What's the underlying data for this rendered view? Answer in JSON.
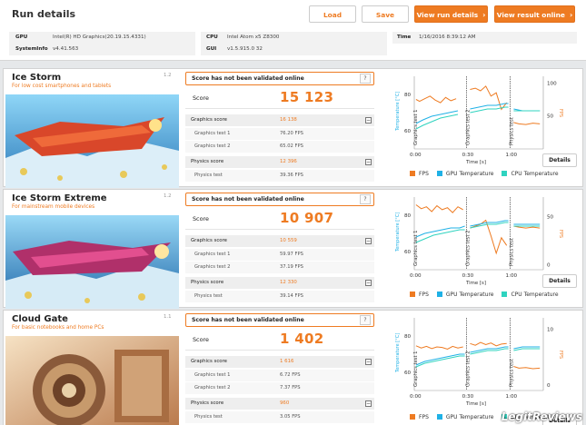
{
  "header": {
    "title": "Run details",
    "load_label": "Load",
    "save_label": "Save",
    "view_run_label": "View run details",
    "view_result_label": "View result online",
    "gpu_key": "GPU",
    "gpu_value": "Intel(R) HD Graphics(20.19.15.4331)",
    "cpu_key": "CPU",
    "cpu_value": "Intel Atom x5 Z8300",
    "time_key": "Time",
    "time_value": "1/16/2016 8:39:12 AM",
    "sysinfo_key": "SystemInfo",
    "sysinfo_value": "v4.41.563",
    "gui_key": "GUI",
    "gui_value": "v1.5.915.0 32"
  },
  "common": {
    "not_validated": "Score has not been validated online",
    "question": "?",
    "score_label": "Score",
    "graphics_score_label": "Graphics score",
    "physics_score_label": "Physics score",
    "gt1_label": "Graphics test 1",
    "gt2_label": "Graphics test 2",
    "pt_label": "Physics test",
    "details_label": "Details",
    "time_axis_label": "Time [s]",
    "temp_axis_label": "Temperature [°C]",
    "fps_axis_label": "FPS",
    "legend_fps": "FPS",
    "legend_gpu": "GPU Temperature",
    "legend_cpu": "CPU Temperature",
    "x_ticks": [
      "0:00",
      "0:30",
      "1:00"
    ],
    "watermark": "LegitReviews"
  },
  "colors": {
    "accent": "#ee7b22",
    "gpu": "#1fb1e6",
    "cpu": "#2fd3bf"
  },
  "benchmarks": [
    {
      "name": "Ice Storm",
      "subtitle": "For low cost smartphones and tablets",
      "version": "1.2",
      "score": "15 123",
      "graphics_score": "16 138",
      "gt1": "76.20 FPS",
      "gt2": "65.02 FPS",
      "physics_score": "12 396",
      "physics_test": "39.36 FPS",
      "temp_ticks": [
        "80",
        "60"
      ],
      "fps_ticks": [
        "100",
        "50"
      ],
      "chart_data": {
        "type": "line",
        "segments": [
          "Graphics test 1",
          "Graphics test 2",
          "Physics test"
        ],
        "series": [
          {
            "name": "FPS",
            "x_s": [
              1,
              3,
              6,
              9,
              12,
              15,
              18,
              21,
              24,
              32,
              35,
              38,
              41,
              44,
              47,
              50,
              53,
              57,
              60,
              64,
              68,
              72
            ],
            "y": [
              75,
              72,
              76,
              80,
              74,
              70,
              78,
              73,
              76,
              90,
              92,
              88,
              95,
              80,
              85,
              60,
              70,
              40,
              38,
              37,
              39,
              38
            ]
          },
          {
            "name": "GPU Temperature",
            "x_s": [
              1,
              5,
              10,
              15,
              20,
              25,
              32,
              37,
              42,
              47,
              52,
              54,
              57,
              62,
              67,
              72
            ],
            "y": [
              64,
              66,
              68,
              69,
              70,
              71,
              72,
              73,
              74,
              74,
              75,
              75,
              72,
              71,
              71,
              71
            ]
          },
          {
            "name": "CPU Temperature",
            "x_s": [
              1,
              5,
              10,
              15,
              20,
              25,
              32,
              37,
              42,
              47,
              52,
              54,
              57,
              62,
              67,
              72
            ],
            "y": [
              61,
              63,
              65,
              67,
              68,
              69,
              70,
              71,
              72,
              72,
              73,
              73,
              71,
              71,
              71,
              71
            ]
          }
        ],
        "temp_range": [
          50,
          90
        ],
        "fps_range": [
          0,
          110
        ]
      }
    },
    {
      "name": "Ice Storm Extreme",
      "subtitle": "For mainstream mobile devices",
      "version": "1.2",
      "score": "10 907",
      "graphics_score": "10 559",
      "gt1": "59.97 FPS",
      "gt2": "37.19 FPS",
      "physics_score": "12 330",
      "physics_test": "39.14 FPS",
      "temp_ticks": [
        "80",
        "60"
      ],
      "fps_ticks": [
        "50",
        "0"
      ],
      "chart_data": {
        "type": "line",
        "segments": [
          "Graphics test 1",
          "Graphics test 2",
          "Physics test"
        ],
        "series": [
          {
            "name": "FPS",
            "x_s": [
              1,
              4,
              7,
              10,
              13,
              16,
              19,
              22,
              25,
              28,
              32,
              35,
              38,
              41,
              44,
              47,
              50,
              53,
              57,
              60,
              64,
              68,
              72
            ],
            "y": [
              62,
              58,
              60,
              55,
              61,
              57,
              59,
              54,
              60,
              57,
              38,
              40,
              42,
              46,
              30,
              12,
              28,
              20,
              40,
              39,
              38,
              39,
              38
            ]
          },
          {
            "name": "GPU Temperature",
            "x_s": [
              1,
              6,
              11,
              16,
              21,
              26,
              29,
              32,
              37,
              42,
              47,
              52,
              54,
              57,
              62,
              67,
              72
            ],
            "y": [
              68,
              70,
              71,
              72,
              73,
              73,
              74,
              74,
              75,
              76,
              76,
              77,
              77,
              75,
              75,
              75,
              75
            ]
          },
          {
            "name": "CPU Temperature",
            "x_s": [
              1,
              6,
              11,
              16,
              21,
              26,
              29,
              32,
              37,
              42,
              47,
              52,
              54,
              57,
              62,
              67,
              72
            ],
            "y": [
              65,
              67,
              69,
              70,
              71,
              72,
              72,
              73,
              74,
              75,
              75,
              76,
              76,
              74,
              74,
              74,
              74
            ]
          }
        ],
        "temp_range": [
          50,
          90
        ],
        "fps_range": [
          -5,
          70
        ]
      }
    },
    {
      "name": "Cloud Gate",
      "subtitle": "For basic notebooks and home PCs",
      "version": "1.1",
      "score": "1 402",
      "graphics_score": "1 616",
      "gt1": "6.72 FPS",
      "gt2": "7.37 FPS",
      "physics_score": "960",
      "physics_test": "3.05 FPS",
      "temp_ticks": [
        "80",
        "60"
      ],
      "fps_ticks": [
        "10",
        "0"
      ],
      "chart_data": {
        "type": "line",
        "segments": [
          "Graphics test 1",
          "Graphics test 2",
          "Physics test"
        ],
        "series": [
          {
            "name": "FPS",
            "x_s": [
              1,
              4,
              7,
              10,
              13,
              16,
              19,
              22,
              25,
              28,
              32,
              35,
              38,
              41,
              44,
              47,
              50,
              53,
              57,
              60,
              64,
              68,
              72
            ],
            "y": [
              7,
              6.6,
              6.9,
              6.5,
              6.8,
              6.7,
              6.4,
              6.9,
              6.6,
              6.8,
              7.4,
              7.1,
              7.6,
              7.2,
              7.5,
              7.0,
              7.3,
              7.4,
              3.3,
              3.0,
              3.1,
              2.9,
              3.0
            ]
          },
          {
            "name": "GPU Temperature",
            "x_s": [
              1,
              6,
              11,
              16,
              21,
              26,
              29,
              32,
              37,
              42,
              47,
              52,
              54,
              57,
              62,
              67,
              72
            ],
            "y": [
              64,
              66,
              67,
              68,
              69,
              70,
              70,
              71,
              72,
              73,
              73,
              74,
              74,
              73,
              74,
              74,
              74
            ]
          },
          {
            "name": "CPU Temperature",
            "x_s": [
              1,
              6,
              11,
              16,
              21,
              26,
              29,
              32,
              37,
              42,
              47,
              52,
              54,
              57,
              62,
              67,
              72
            ],
            "y": [
              63,
              65,
              66,
              67,
              68,
              69,
              69,
              70,
              71,
              72,
              72,
              73,
              73,
              72,
              73,
              73,
              73
            ]
          }
        ],
        "temp_range": [
          50,
          90
        ],
        "fps_range": [
          -1,
          12
        ]
      }
    }
  ]
}
